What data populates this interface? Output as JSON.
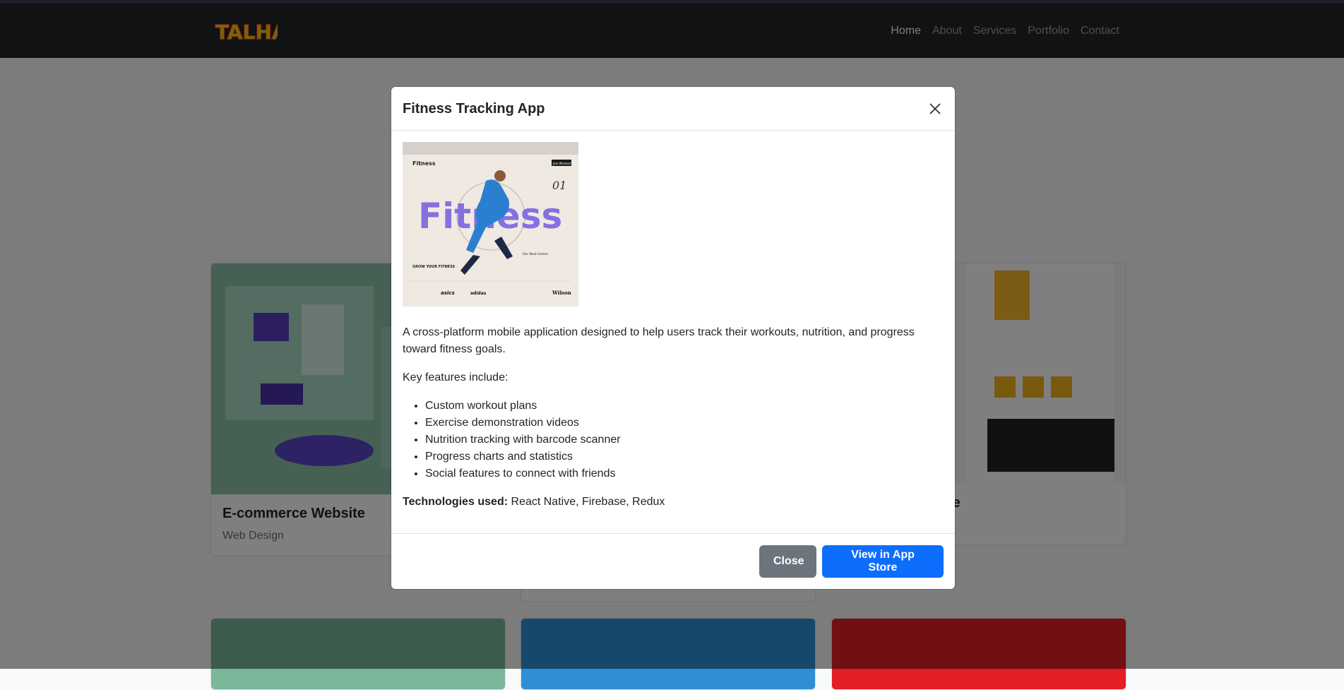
{
  "brand": {
    "logo_text": "TALHA"
  },
  "nav": {
    "items": [
      {
        "label": "Home",
        "active": true
      },
      {
        "label": "About",
        "active": false
      },
      {
        "label": "Services",
        "active": false
      },
      {
        "label": "Portfolio",
        "active": false
      },
      {
        "label": "Contact",
        "active": false
      }
    ]
  },
  "background_cards": [
    {
      "title": "E-commerce Website",
      "category": "Web Design"
    },
    {
      "title": "te",
      "category": ""
    }
  ],
  "modal": {
    "title": "Fitness Tracking App",
    "image": {
      "brand": "Fitness",
      "hero_word": "Fitness",
      "number": "01",
      "tagline": "GROW YOUR FITNESS",
      "nav_button": "Join Workout",
      "trainers_label": "Our Best trainer",
      "sponsors": [
        "asics",
        "adidas",
        "Wilson"
      ]
    },
    "description": "A cross-platform mobile application designed to help users track their workouts, nutrition, and progress toward fitness goals.",
    "features_intro": "Key features include:",
    "features": [
      "Custom workout plans",
      "Exercise demonstration videos",
      "Nutrition tracking with barcode scanner",
      "Progress charts and statistics",
      "Social features to connect with friends"
    ],
    "tech_label": "Technologies used:",
    "tech_value": " React Native, Firebase, Redux",
    "close_button": "Close",
    "store_button": "View in App Store"
  },
  "colors": {
    "navbar": "#212529",
    "primary": "#0d6efd",
    "secondary": "#6c757d",
    "logo_red": "#d7261e",
    "logo_yellow": "#f6c21b"
  }
}
